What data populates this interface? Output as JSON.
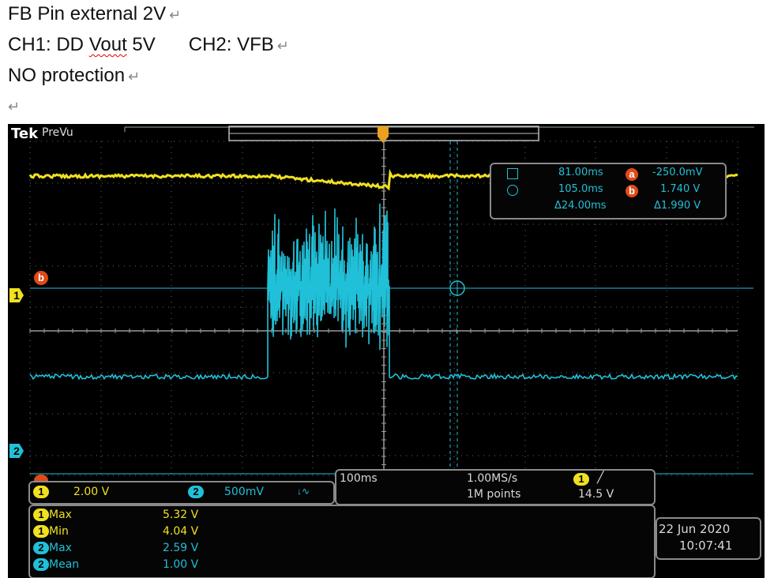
{
  "doc": {
    "line1": "FB Pin external 2V",
    "line2_a": "CH1: DD ",
    "line2_b": "Vout",
    "line2_c": " 5V",
    "line2_ch2": "CH2: VFB",
    "line3": "NO protection",
    "return_mark": "↵"
  },
  "scope": {
    "brand": "Tek",
    "mode": "PreVu",
    "cursors": {
      "a_time": "81.00ms",
      "b_time": "105.0ms",
      "delta_time": "Δ24.00ms",
      "a_volt": "-250.0mV",
      "b_volt": "1.740 V",
      "delta_volt": "Δ1.990 V",
      "a_label": "a",
      "b_label": "b"
    },
    "markers": {
      "ch1": "1",
      "ch2": "2",
      "b_marker": "b",
      "trigger": "T"
    },
    "channels": {
      "ch1_num": "1",
      "ch1_scale": "2.00 V",
      "ch2_num": "2",
      "ch2_scale": "500mV",
      "bw_icon": "bandwidth-limit-icon"
    },
    "timebase": {
      "scale": "100ms",
      "sample_rate": "1.00MS/s",
      "record": "1M points",
      "trig_src": "1",
      "trig_level": "14.5 V",
      "trig_slope_icon": "rising-edge-icon"
    },
    "measurements": [
      {
        "ch": "1",
        "name": "Max",
        "value": "5.32 V",
        "color": "yellow"
      },
      {
        "ch": "1",
        "name": "Min",
        "value": "4.04 V",
        "color": "yellow"
      },
      {
        "ch": "2",
        "name": "Max",
        "value": "2.59 V",
        "color": "cyan"
      },
      {
        "ch": "2",
        "name": "Mean",
        "value": "1.00 V",
        "color": "cyan"
      }
    ],
    "date": "22 Jun  2020",
    "time": "10:07:41"
  },
  "colors": {
    "ch1": "#f0e020",
    "ch2": "#20c0d8",
    "cursor": "#e04a18",
    "graticule": "#6a6a6a"
  }
}
